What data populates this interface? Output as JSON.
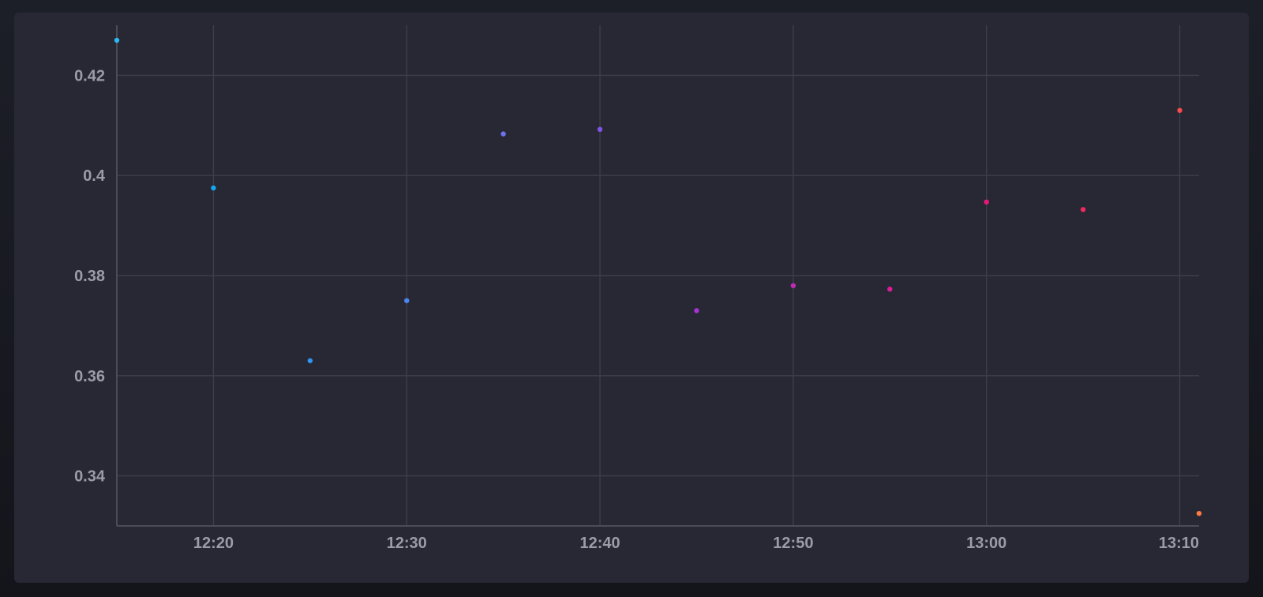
{
  "chart_data": {
    "type": "scatter",
    "title": "",
    "xlabel": "",
    "ylabel": "",
    "x_ticks": [
      "12:20",
      "12:30",
      "12:40",
      "12:50",
      "13:00",
      "13:10"
    ],
    "y_ticks": [
      "0.34",
      "0.36",
      "0.38",
      "0.4",
      "0.42"
    ],
    "ylim": [
      0.33,
      0.43
    ],
    "xlim": [
      "12:15",
      "13:11"
    ],
    "grid": true,
    "series": [
      {
        "points": [
          {
            "x": "12:15",
            "y": 0.427,
            "color": "#2bb8f2"
          },
          {
            "x": "12:20",
            "y": 0.3975,
            "color": "#16a6ee"
          },
          {
            "x": "12:25",
            "y": 0.363,
            "color": "#2f95f3"
          },
          {
            "x": "12:30",
            "y": 0.375,
            "color": "#4a86ee"
          },
          {
            "x": "12:35",
            "y": 0.4083,
            "color": "#6d72ee"
          },
          {
            "x": "12:40",
            "y": 0.4092,
            "color": "#8055e6"
          },
          {
            "x": "12:45",
            "y": 0.373,
            "color": "#a633d6"
          },
          {
            "x": "12:50",
            "y": 0.378,
            "color": "#c02bb4"
          },
          {
            "x": "12:55",
            "y": 0.3773,
            "color": "#d81f98"
          },
          {
            "x": "13:00",
            "y": 0.3947,
            "color": "#e8177a"
          },
          {
            "x": "13:05",
            "y": 0.3932,
            "color": "#f02962"
          },
          {
            "x": "13:10",
            "y": 0.413,
            "color": "#fa4a4a"
          },
          {
            "x": "13:11",
            "y": 0.3325,
            "color": "#ff7a45"
          }
        ]
      }
    ]
  }
}
